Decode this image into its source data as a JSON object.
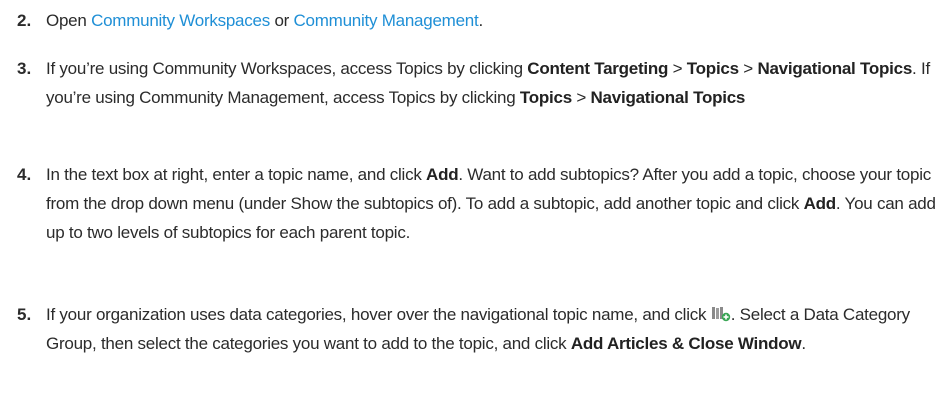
{
  "steps": [
    {
      "number": "2.",
      "text_open": "Open ",
      "link1": "Community Workspaces",
      "text_or": " or ",
      "link2": "Community Management",
      "text_end": "."
    },
    {
      "number": "3.",
      "t1": "If you’re using Community Workspaces, access Topics by clicking ",
      "b1": "Content Targeting",
      "t2": " > ",
      "b2": "Topics",
      "t3": " > ",
      "b3": "Navigational Topics",
      "t4": ". If you’re using Community Management, access Topics by clicking ",
      "b4": "Topics",
      "t5": " > ",
      "b5": "Navigational Topics"
    },
    {
      "number": "4.",
      "t1": "In the text box at right, enter a topic name, and click ",
      "b1": "Add",
      "t2": ". Want to add subtopics? After you add a topic, choose your topic from the drop down menu (under Show the subtopics of). To add a subtopic, add another topic and click ",
      "b2": "Add",
      "t3": ". You can add up to two levels of subtopics for each parent topic."
    },
    {
      "number": "5.",
      "t1": "If your organization uses data categories, hover over the navigational topic name, and click ",
      "icon": "add-articles-icon",
      "t2": ". Select a Data Category Group, then select the categories you want to add to the topic, and click ",
      "b1": "Add Articles & Close Window",
      "t3": "."
    }
  ],
  "colors": {
    "link": "#1f8fd6",
    "text": "#2b2b2b",
    "icon_gray": "#8a8a8a",
    "icon_green": "#3aa655"
  }
}
